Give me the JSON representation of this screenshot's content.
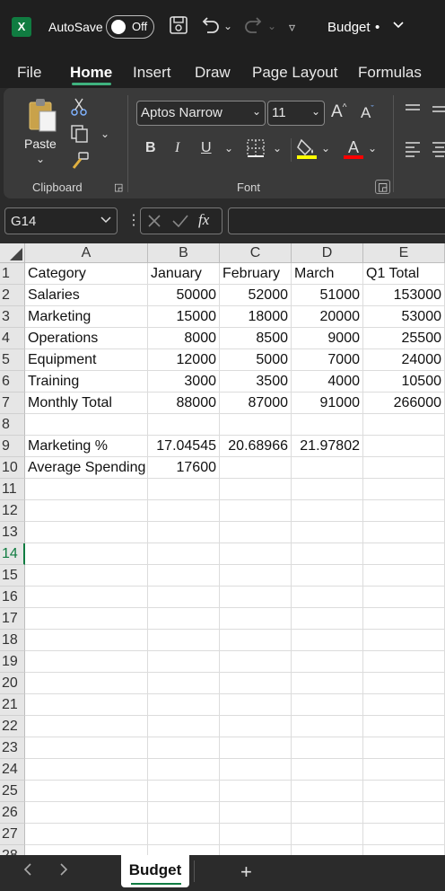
{
  "titlebar": {
    "logo": "X",
    "autosave_label": "AutoSave",
    "autosave_state": "Off",
    "doc_title": "Budget",
    "doc_dot": "•",
    "icons": [
      "save-icon",
      "undo-icon",
      "redo-icon",
      "customize-icon"
    ]
  },
  "menu": {
    "tabs": [
      "File",
      "Home",
      "Insert",
      "Draw",
      "Page Layout",
      "Formulas"
    ],
    "active": "Home"
  },
  "ribbon": {
    "clipboard": {
      "paste_label": "Paste",
      "group_label": "Clipboard"
    },
    "font": {
      "font_name": "Aptos Narrow",
      "font_size": "11",
      "bold": "B",
      "italic": "I",
      "underline": "U",
      "group_label": "Font",
      "highlight_color": "#ffff00",
      "font_color": "#ff0000",
      "font_color_letter": "A"
    }
  },
  "formula_bar": {
    "name_box": "G14",
    "fx": "fx",
    "formula": ""
  },
  "grid": {
    "columns": [
      "A",
      "B",
      "C",
      "D",
      "E"
    ],
    "selected_row": "14",
    "rows": [
      {
        "n": "1",
        "cells": [
          "Category",
          "January",
          "February",
          "March",
          "Q1 Total"
        ]
      },
      {
        "n": "2",
        "cells": [
          "Salaries",
          "50000",
          "52000",
          "51000",
          "153000"
        ]
      },
      {
        "n": "3",
        "cells": [
          "Marketing",
          "15000",
          "18000",
          "20000",
          "53000"
        ]
      },
      {
        "n": "4",
        "cells": [
          "Operations",
          "8000",
          "8500",
          "9000",
          "25500"
        ]
      },
      {
        "n": "5",
        "cells": [
          "Equipment",
          "12000",
          "5000",
          "7000",
          "24000"
        ]
      },
      {
        "n": "6",
        "cells": [
          "Training",
          "3000",
          "3500",
          "4000",
          "10500"
        ]
      },
      {
        "n": "7",
        "cells": [
          "Monthly Total",
          "88000",
          "87000",
          "91000",
          "266000"
        ]
      },
      {
        "n": "8",
        "cells": [
          "",
          "",
          "",
          "",
          ""
        ]
      },
      {
        "n": "9",
        "cells": [
          "Marketing %",
          "17.04545",
          "20.68966",
          "21.97802",
          ""
        ]
      },
      {
        "n": "10",
        "cells": [
          "Average Spending",
          "17600",
          "",
          "",
          ""
        ]
      },
      {
        "n": "11",
        "cells": [
          "",
          "",
          "",
          "",
          ""
        ]
      },
      {
        "n": "12",
        "cells": [
          "",
          "",
          "",
          "",
          ""
        ]
      },
      {
        "n": "13",
        "cells": [
          "",
          "",
          "",
          "",
          ""
        ]
      },
      {
        "n": "14",
        "cells": [
          "",
          "",
          "",
          "",
          ""
        ]
      },
      {
        "n": "15",
        "cells": [
          "",
          "",
          "",
          "",
          ""
        ]
      },
      {
        "n": "16",
        "cells": [
          "",
          "",
          "",
          "",
          ""
        ]
      },
      {
        "n": "17",
        "cells": [
          "",
          "",
          "",
          "",
          ""
        ]
      },
      {
        "n": "18",
        "cells": [
          "",
          "",
          "",
          "",
          ""
        ]
      },
      {
        "n": "19",
        "cells": [
          "",
          "",
          "",
          "",
          ""
        ]
      },
      {
        "n": "20",
        "cells": [
          "",
          "",
          "",
          "",
          ""
        ]
      },
      {
        "n": "21",
        "cells": [
          "",
          "",
          "",
          "",
          ""
        ]
      },
      {
        "n": "22",
        "cells": [
          "",
          "",
          "",
          "",
          ""
        ]
      },
      {
        "n": "23",
        "cells": [
          "",
          "",
          "",
          "",
          ""
        ]
      },
      {
        "n": "24",
        "cells": [
          "",
          "",
          "",
          "",
          ""
        ]
      },
      {
        "n": "25",
        "cells": [
          "",
          "",
          "",
          "",
          ""
        ]
      },
      {
        "n": "26",
        "cells": [
          "",
          "",
          "",
          "",
          ""
        ]
      },
      {
        "n": "27",
        "cells": [
          "",
          "",
          "",
          "",
          ""
        ]
      },
      {
        "n": "28",
        "cells": [
          "",
          "",
          "",
          "",
          ""
        ]
      }
    ]
  },
  "sheets": {
    "tabs": [
      "Budget"
    ],
    "add_label": "+"
  },
  "colors": {
    "accent": "#107c41",
    "titlebar_bg": "#1f1f1f",
    "ribbon_bg": "#3a3a3a"
  }
}
